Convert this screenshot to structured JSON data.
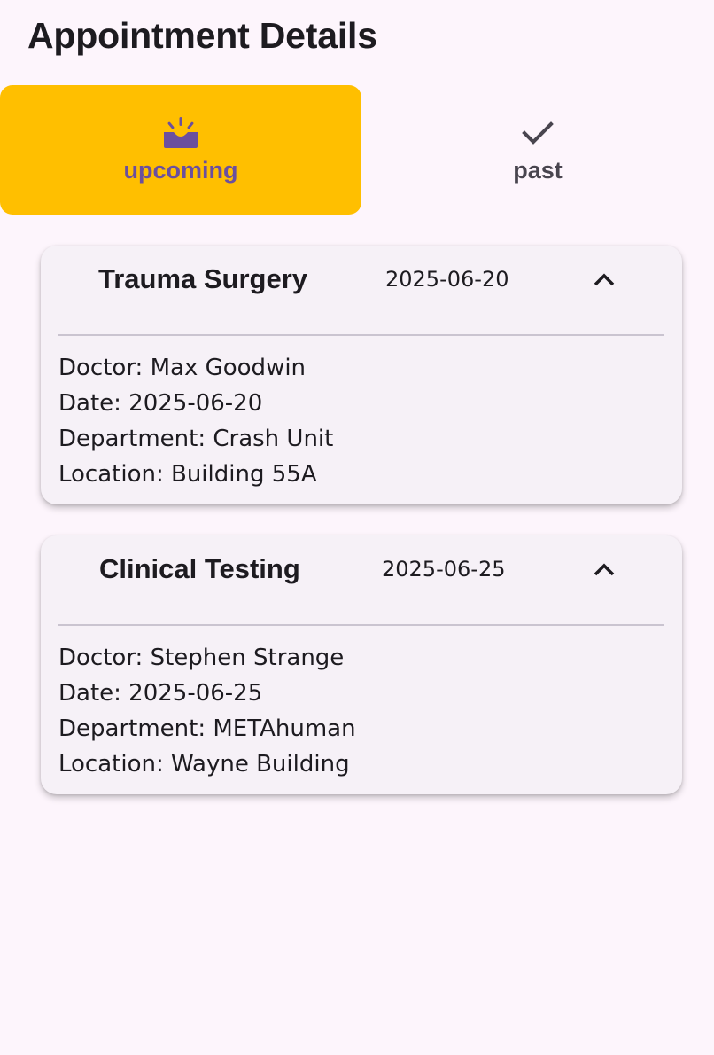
{
  "page": {
    "title": "Appointment Details"
  },
  "tabs": [
    {
      "label": "upcoming",
      "icon": "upcoming-icon",
      "selected": true
    },
    {
      "label": "past",
      "icon": "check-icon",
      "selected": false
    }
  ],
  "colors": {
    "selected_tab_bg": "#ffbf00",
    "accent": "#6b4f9e",
    "background": "#fdf5fc",
    "card_bg": "#f6f1f7"
  },
  "appointments": [
    {
      "title": "Trauma Surgery",
      "date": "2025-06-20",
      "expanded": true,
      "toggle_icon": "chevron-up-icon",
      "details": [
        "Doctor: Max Goodwin",
        "Date: 2025-06-20",
        "Department: Crash Unit",
        "Location: Building 55A"
      ]
    },
    {
      "title": "Clinical Testing",
      "date": "2025-06-25",
      "expanded": true,
      "toggle_icon": "chevron-up-icon",
      "details": [
        "Doctor: Stephen Strange",
        "Date: 2025-06-25",
        "Department: METAhuman",
        "Location: Wayne Building"
      ]
    }
  ]
}
